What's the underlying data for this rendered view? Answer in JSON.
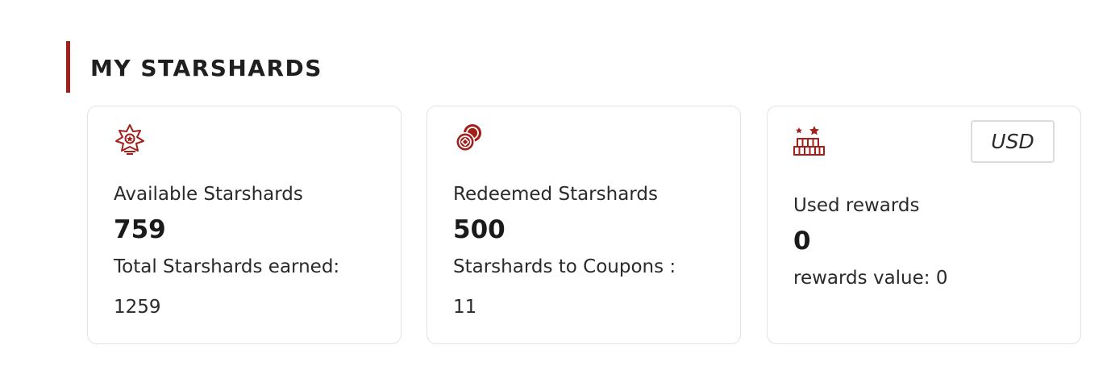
{
  "section": {
    "title": "MY STARSHARDS"
  },
  "colors": {
    "accent": "#a1201c",
    "card_border": "#e3e3e3",
    "text": "#222222"
  },
  "cards": [
    {
      "icon": "star-badge-icon",
      "label": "Available Starshards",
      "value": "759",
      "sub_label": "Total Starshards earned:",
      "sub_value": "1259"
    },
    {
      "icon": "coins-icon",
      "label": "Redeemed Starshards",
      "value": "500",
      "sub_label": "Starshards to Coupons :",
      "sub_value": "11"
    },
    {
      "icon": "gift-stack-icon",
      "label": "Used rewards",
      "value": "0",
      "sub_label": "rewards value: 0",
      "currency": "USD"
    }
  ]
}
